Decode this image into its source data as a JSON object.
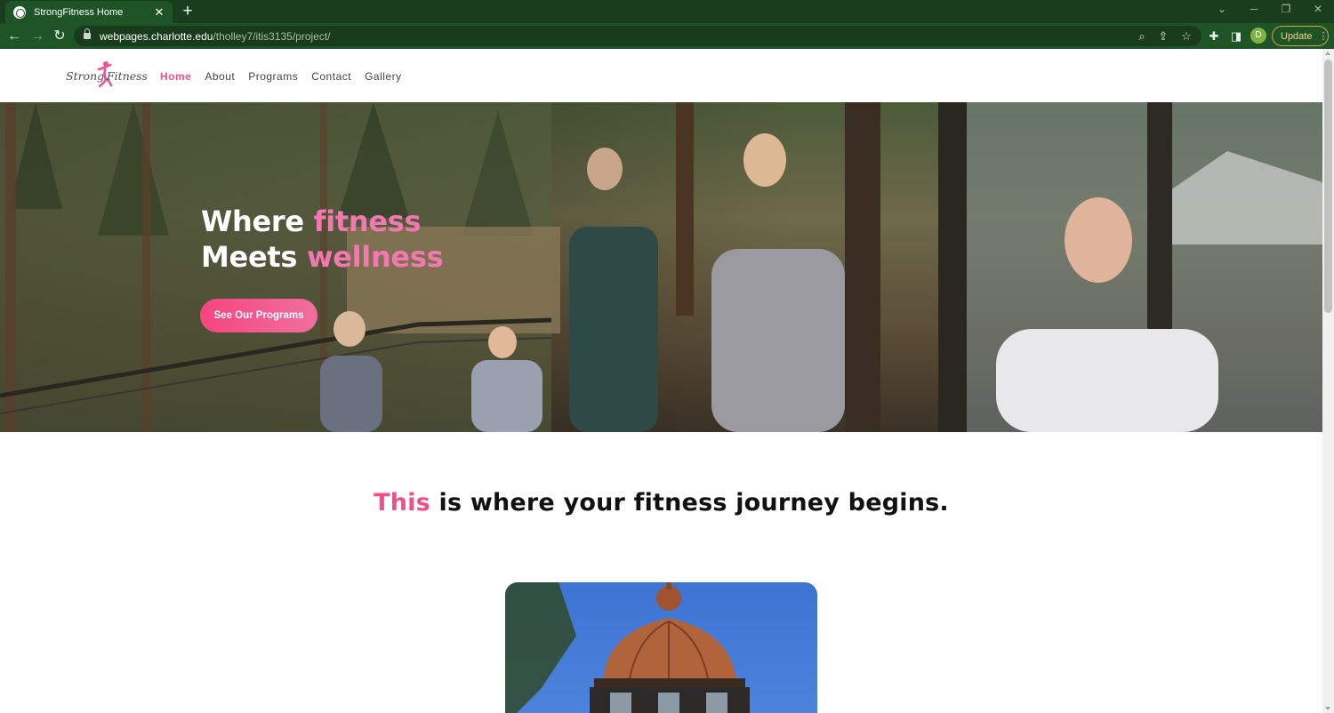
{
  "browser": {
    "tab_title": "StrongFitness Home",
    "url_host": "webpages.charlotte.edu",
    "url_path": "/tholley7/itis3135/project/",
    "profile_initial": "D",
    "update_label": "Update"
  },
  "site": {
    "logo_left": "Strong",
    "logo_right": "Fitness",
    "nav": [
      {
        "label": "Home",
        "active": true
      },
      {
        "label": "About"
      },
      {
        "label": "Programs"
      },
      {
        "label": "Contact"
      },
      {
        "label": "Gallery"
      }
    ]
  },
  "hero": {
    "line1_prefix": "Where ",
    "line1_highlight": "fitness",
    "line2_prefix": "Meets ",
    "line2_highlight": "wellness",
    "cta_label": "See Our Programs"
  },
  "intro": {
    "highlight": "This",
    "rest": " is where your fitness journey begins."
  },
  "colors": {
    "accent": "#ee5290",
    "browser_frame": "#1e5426"
  }
}
